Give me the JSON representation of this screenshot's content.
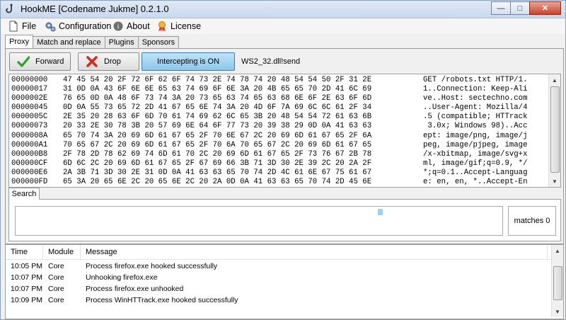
{
  "window": {
    "title": "HookME [Codename Jukme] 0.2.1.0",
    "icon": "hook-icon",
    "controls": {
      "minimize_glyph": "—",
      "maximize_glyph": "□",
      "close_glyph": "✕"
    }
  },
  "menubar": {
    "items": [
      {
        "label": "File",
        "icon": "file-icon"
      },
      {
        "label": "Configuration",
        "icon": "gears-icon"
      },
      {
        "label": "About",
        "icon": "info-icon"
      },
      {
        "label": "License",
        "icon": "license-icon"
      }
    ]
  },
  "tabs": [
    {
      "label": "Proxy",
      "active": true
    },
    {
      "label": "Match and replace",
      "active": false
    },
    {
      "label": "Plugins",
      "active": false
    },
    {
      "label": "Sponsors",
      "active": false
    }
  ],
  "proxy": {
    "forward_label": "Forward",
    "drop_label": "Drop",
    "intercept_label": "Intercepting is ON",
    "target_function": "WS2_32.dll!send"
  },
  "hex_rows": [
    {
      "addr": "00000000",
      "bytes": "47 45 54 20 2F 72 6F 62 6F 74 73 2E 74 78 74 20 48 54 54 50 2F 31 2E",
      "ascii": "GET /robots.txt HTTP/1."
    },
    {
      "addr": "00000017",
      "bytes": "31 0D 0A 43 6F 6E 6E 65 63 74 69 6F 6E 3A 20 4B 65 65 70 2D 41 6C 69",
      "ascii": "1..Connection: Keep-Ali"
    },
    {
      "addr": "0000002E",
      "bytes": "76 65 0D 0A 48 6F 73 74 3A 20 73 65 63 74 65 63 68 6E 6F 2E 63 6F 6D",
      "ascii": "ve..Host: sectechno.com"
    },
    {
      "addr": "00000045",
      "bytes": "0D 0A 55 73 65 72 2D 41 67 65 6E 74 3A 20 4D 6F 7A 69 6C 6C 61 2F 34",
      "ascii": "..User-Agent: Mozilla/4"
    },
    {
      "addr": "0000005C",
      "bytes": "2E 35 20 28 63 6F 6D 70 61 74 69 62 6C 65 3B 20 48 54 54 72 61 63 6B",
      "ascii": ".5 (compatible; HTTrack"
    },
    {
      "addr": "00000073",
      "bytes": "20 33 2E 30 78 3B 20 57 69 6E 64 6F 77 73 20 39 38 29 0D 0A 41 63 63",
      "ascii": " 3.0x; Windows 98)..Acc"
    },
    {
      "addr": "0000008A",
      "bytes": "65 70 74 3A 20 69 6D 61 67 65 2F 70 6E 67 2C 20 69 6D 61 67 65 2F 6A",
      "ascii": "ept: image/png, image/j"
    },
    {
      "addr": "000000A1",
      "bytes": "70 65 67 2C 20 69 6D 61 67 65 2F 70 6A 70 65 67 2C 20 69 6D 61 67 65",
      "ascii": "peg, image/pjpeg, image"
    },
    {
      "addr": "000000B8",
      "bytes": "2F 78 2D 78 62 69 74 6D 61 70 2C 20 69 6D 61 67 65 2F 73 76 67 2B 78",
      "ascii": "/x-xbitmap, image/svg+x"
    },
    {
      "addr": "000000CF",
      "bytes": "6D 6C 2C 20 69 6D 61 67 65 2F 67 69 66 3B 71 3D 30 2E 39 2C 20 2A 2F",
      "ascii": "ml, image/gif;q=0.9, */"
    },
    {
      "addr": "000000E6",
      "bytes": "2A 3B 71 3D 30 2E 31 0D 0A 41 63 63 65 70 74 2D 4C 61 6E 67 75 61 67",
      "ascii": "*;q=0.1..Accept-Languag"
    },
    {
      "addr": "000000FD",
      "bytes": "65 3A 20 65 6E 2C 20 65 6E 2C 20 2A 0D 0A 41 63 63 65 70 74 2D 45 6E",
      "ascii": "e: en, en, *..Accept-En"
    }
  ],
  "search": {
    "tab_label": "Search",
    "query": "",
    "matches_label": "matches 0"
  },
  "log": {
    "columns": [
      "Time",
      "Module",
      "Message"
    ],
    "rows": [
      {
        "time": "10:05 PM",
        "module": "Core",
        "message": "Process firefox.exe hooked successfully"
      },
      {
        "time": "10:07 PM",
        "module": "Core",
        "message": "Unhooking firefox.exe"
      },
      {
        "time": "10:07 PM",
        "module": "Core",
        "message": "Process firefox.exe unhooked"
      },
      {
        "time": "10:09 PM",
        "module": "Core",
        "message": "Process WinHTTrack.exe hooked successfully"
      }
    ]
  },
  "colors": {
    "intercept_on": "#9fd2f2",
    "forward_check": "#2f9e2f",
    "drop_x": "#d32a1e"
  }
}
